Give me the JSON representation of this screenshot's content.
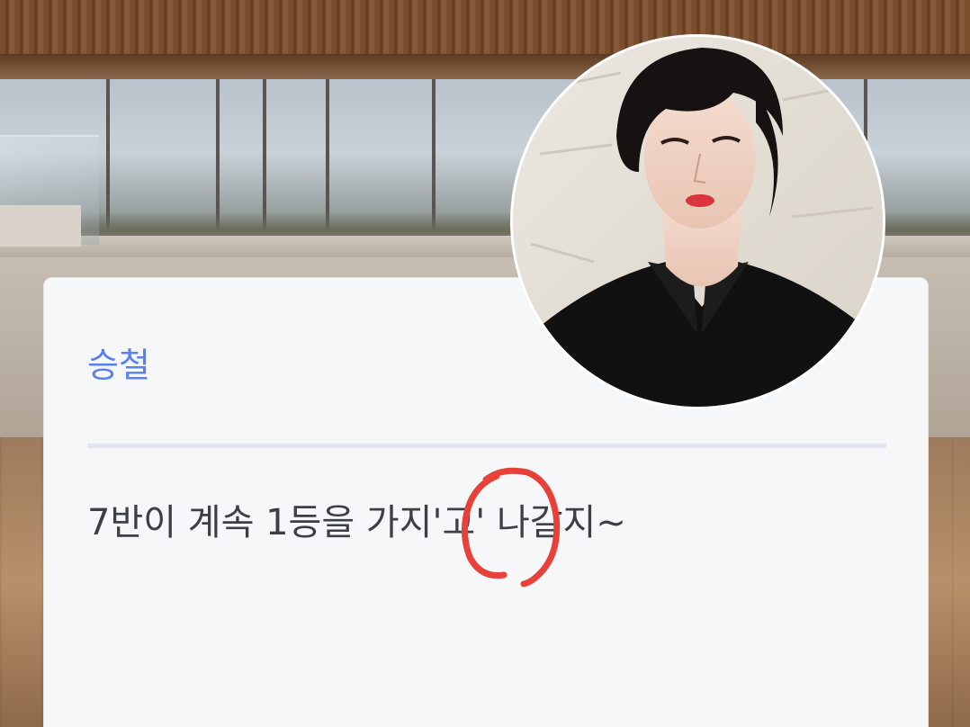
{
  "card": {
    "name": "승철",
    "message": "7반이 계속 1등을 가지'고' 나갈지~"
  },
  "colors": {
    "name_accent": "#5b7ff0",
    "message_text": "#3c4046",
    "card_background": "#f6f7f8",
    "annotation_stroke": "#e8413a"
  },
  "icons": {
    "avatar": "profile-photo",
    "annotation": "hand-drawn-circle"
  }
}
